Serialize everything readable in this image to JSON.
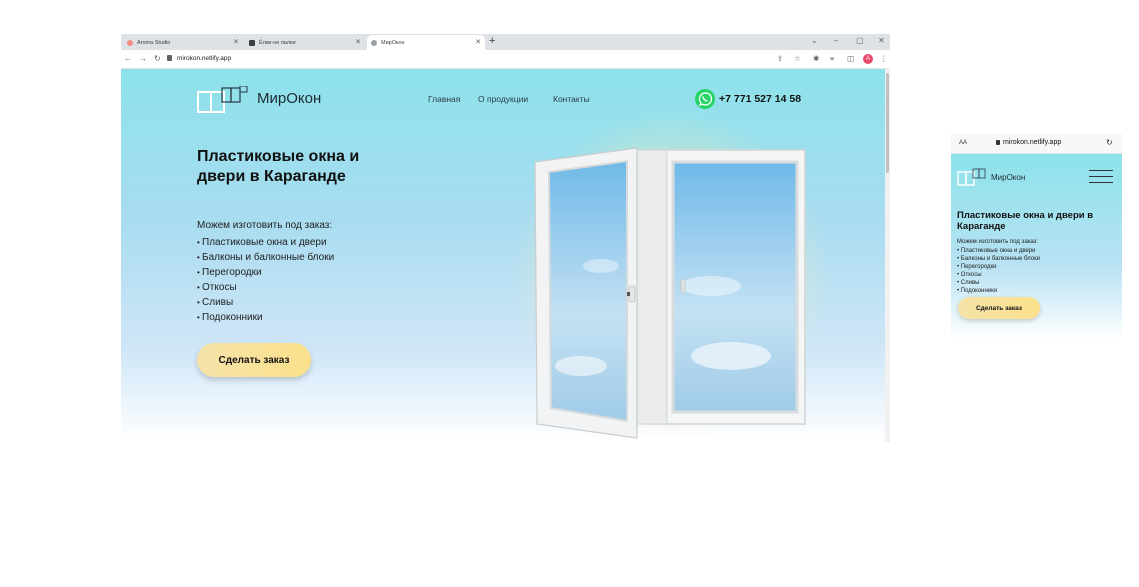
{
  "browser": {
    "tabs": [
      {
        "label": "Aroma Studio",
        "favicon_color": "#f28b82"
      },
      {
        "label": "Ёлки-не палки",
        "favicon_color": "#3c4043"
      },
      {
        "label": "МирОкон",
        "favicon_color": "#9aa0a6"
      }
    ],
    "new_tab": "+",
    "url": "mirokon.netlify.app",
    "profile_initial": "A",
    "window_controls": [
      "⌄",
      "–",
      "▢",
      "✕"
    ],
    "toolbar_icons": [
      "share-icon",
      "star-icon",
      "extensions-icon",
      "reading-list-icon",
      "sidepanel-icon"
    ]
  },
  "site": {
    "logo_text": "МирОкон",
    "menu": [
      "Главная",
      "О продукции",
      "Контакты"
    ],
    "phone": "+7 771 527 14 58",
    "heading": "Пластиковые окна и двери в Караганде",
    "lead": "Можем изготовить под заказ:",
    "items": [
      "Пластиковые окна и двери",
      "Балконы и балконные блоки",
      "Перегородки",
      "Откосы",
      "Сливы",
      "Подоконники"
    ],
    "cta": "Сделать заказ"
  },
  "mobile": {
    "aa": "AA",
    "url": "mirokon.netlify.app",
    "reload": "↻",
    "logo_text": "МирОкон",
    "heading": "Пластиковые окна и двери в Караганде",
    "lead": "Можем изготовить под заказ:",
    "items": [
      "Пластиковые окна и двери",
      "Балконы и балконные блоки",
      "Перегородки",
      "Откосы",
      "Сливы",
      "Подоконники"
    ],
    "cta": "Сделать заказ"
  },
  "colors": {
    "accent_gradient_start": "#8ce2ea",
    "cta": "#fbe18c",
    "whatsapp": "#25d366"
  }
}
